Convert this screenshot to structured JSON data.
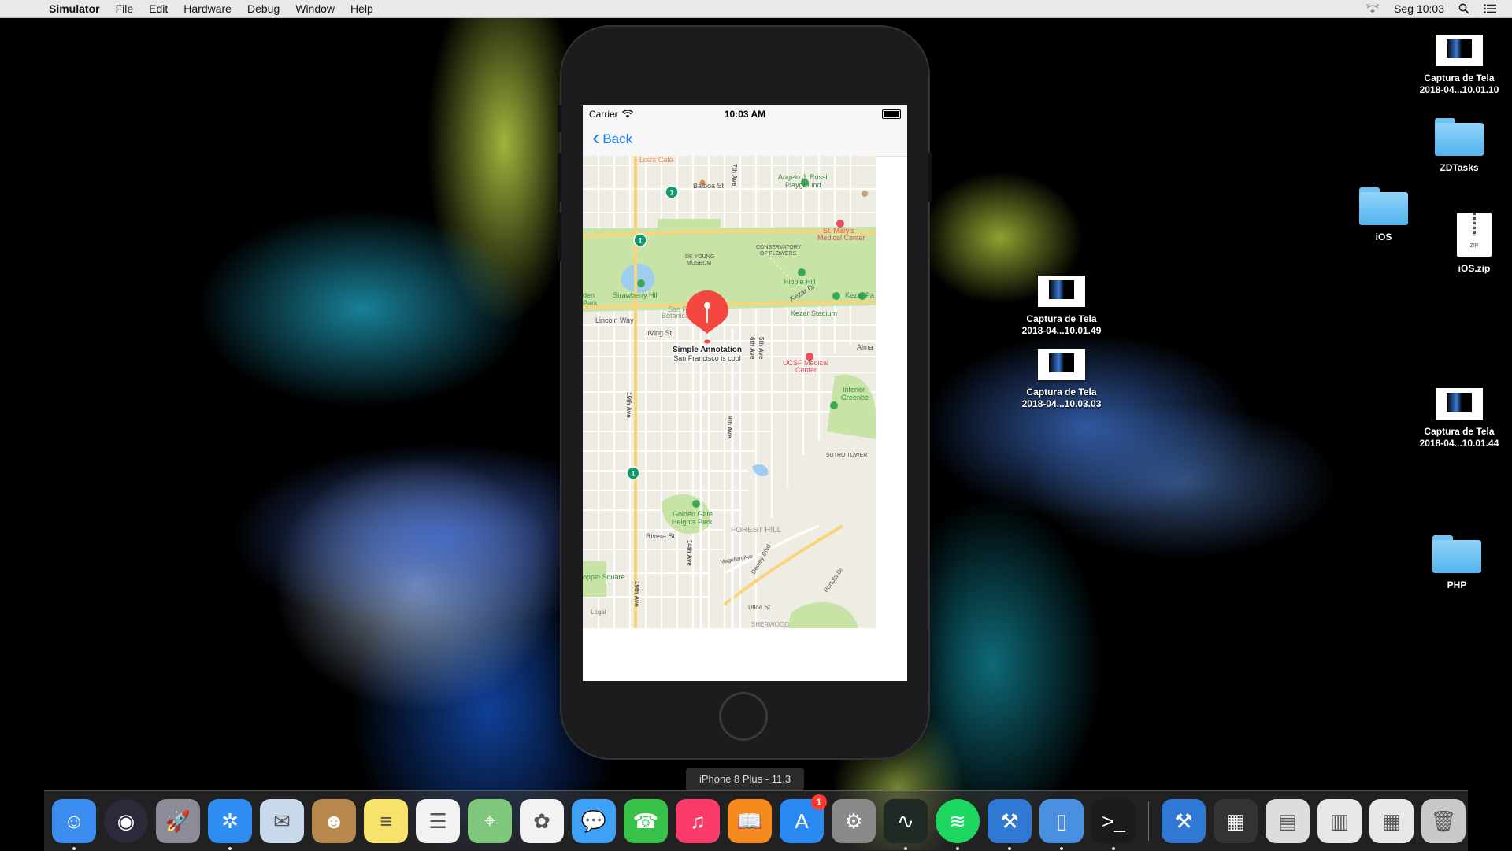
{
  "menubar": {
    "app_name": "Simulator",
    "items": [
      "File",
      "Edit",
      "Hardware",
      "Debug",
      "Window",
      "Help"
    ],
    "clock": "Seg 10:03"
  },
  "desktop": {
    "icons": [
      {
        "label": "Captura de Tela\n2018-04...10.01.10",
        "type": "screenshot"
      },
      {
        "label": "ZDTasks",
        "type": "folder"
      },
      {
        "label": "iOS",
        "type": "folder"
      },
      {
        "label": "iOS.zip",
        "type": "zip"
      },
      {
        "label": "Captura de Tela\n2018-04...10.01.49",
        "type": "screenshot"
      },
      {
        "label": "Captura de Tela\n2018-04...10.03.03",
        "type": "screenshot"
      },
      {
        "label": "Captura de Tela\n2018-04...10.01.44",
        "type": "screenshot"
      },
      {
        "label": "PHP",
        "type": "folder"
      }
    ]
  },
  "simulator": {
    "device_label": "iPhone 8 Plus - 11.3",
    "status_bar": {
      "carrier": "Carrier",
      "time": "10:03 AM"
    },
    "nav": {
      "back_label": "Back"
    },
    "map": {
      "annotation_title": "Simple Annotation",
      "annotation_subtitle": "San Francisco is cool",
      "legal": "Legal",
      "labels": {
        "lous_cafe": "Lou's Cafe",
        "balboa": "Balboa St",
        "rossi": "Angelo J. Rossi",
        "rossi2": "Playground",
        "st_marys": "St. Mary's",
        "st_marys2": "Medical Center",
        "conservatory": "CONSERVATORY",
        "conservatory2": "OF FLOWERS",
        "deyoung": "DE YOUNG",
        "deyoung2": "MUSEUM",
        "hippie": "Hippie Hill",
        "strawberry": "Strawberry Hill",
        "kezar_stadium": "Kezar Stadium",
        "kezar_dr": "Kezar Dr",
        "kezar_pa": "Kezar Pa",
        "botanical": "San Francisco",
        "botanical2": "Botanical Garden",
        "lincoln": "Lincoln Way",
        "irving": "Irving St",
        "ucsf": "UCSF Medical",
        "ucsf2": "Center",
        "interior": "Interior",
        "interior2": "Greenbe",
        "sutro": "SUTRO TOWER",
        "golden_gate": "Golden Gate",
        "golden_gate2": "Heights Park",
        "forest_hill": "FOREST HILL",
        "rivera": "Rivera St",
        "magellan": "Magellan Ave",
        "dewey": "Dewey Blvd",
        "portola": "Portola Dr",
        "ulloa": "Ulloa St",
        "sherwood": "SHERWOOD",
        "shopping_square": "oppin Square",
        "alma": "Alma",
        "seventh_ave": "7th Ave",
        "nineteenth_ave": "19th Ave",
        "ninth_ave": "9th Ave",
        "fifth_ave": "5th Ave",
        "sixth_ave": "6th Ave",
        "fourteenth_ave": "14th Ave",
        "park": "Park",
        "den": "den",
        "route": "1"
      }
    }
  },
  "dock": {
    "apps": [
      {
        "name": "Finder",
        "icon": "finder-icon",
        "color": "#3b8ef0",
        "running": true
      },
      {
        "name": "Siri",
        "icon": "siri-icon",
        "color": "#2a2a3a",
        "running": false
      },
      {
        "name": "Launchpad",
        "icon": "launchpad-icon",
        "color": "#8c8c98",
        "running": false
      },
      {
        "name": "Safari",
        "icon": "safari-icon",
        "color": "#2f8cf0",
        "running": true
      },
      {
        "name": "Mail",
        "icon": "mail-icon",
        "color": "#c9d9ec",
        "running": false
      },
      {
        "name": "Contacts",
        "icon": "contacts-icon",
        "color": "#b8874d",
        "running": false
      },
      {
        "name": "Notes",
        "icon": "notes-icon",
        "color": "#f7e36c",
        "running": false
      },
      {
        "name": "Reminders",
        "icon": "reminders-icon",
        "color": "#f2f2f2",
        "running": false
      },
      {
        "name": "Maps",
        "icon": "maps-icon",
        "color": "#7fc77c",
        "running": false
      },
      {
        "name": "Photos",
        "icon": "photos-icon",
        "color": "#f2f2f2",
        "running": false
      },
      {
        "name": "Messages",
        "icon": "messages-icon",
        "color": "#3fa1f7",
        "running": false
      },
      {
        "name": "FaceTime",
        "icon": "facetime-icon",
        "color": "#39c24a",
        "running": false
      },
      {
        "name": "iTunes",
        "icon": "itunes-icon",
        "color": "#fb3c6a",
        "running": false
      },
      {
        "name": "iBooks",
        "icon": "ibooks-icon",
        "color": "#f58a1f",
        "running": false
      },
      {
        "name": "App Store",
        "icon": "appstore-icon",
        "color": "#2a8af2",
        "running": false,
        "badge": "1"
      },
      {
        "name": "System Preferences",
        "icon": "gear-icon",
        "color": "#8a8a8a",
        "running": false
      },
      {
        "name": "Activity Monitor",
        "icon": "activity-monitor-icon",
        "color": "#1f2a24",
        "running": true
      },
      {
        "name": "Spotify",
        "icon": "spotify-icon",
        "color": "#1ed760",
        "running": true
      },
      {
        "name": "Xcode",
        "icon": "xcode-icon",
        "color": "#2f78d3",
        "running": true
      },
      {
        "name": "Simulator",
        "icon": "simulator-icon",
        "color": "#4a90e2",
        "running": true
      },
      {
        "name": "Terminal",
        "icon": "terminal-icon",
        "color": "#1b1b1b",
        "running": true
      }
    ],
    "others": [
      {
        "name": "Xcode Beta",
        "icon": "xcode-icon",
        "color": "#2f78d3"
      },
      {
        "name": "Screenshot Stack",
        "icon": "stack-icon",
        "color": "#333333"
      },
      {
        "name": "Documents",
        "icon": "documents-stack-icon",
        "color": "#dddddd"
      },
      {
        "name": "Downloads",
        "icon": "downloads-stack-icon",
        "color": "#e8e8e8"
      },
      {
        "name": "Applications",
        "icon": "applications-stack-icon",
        "color": "#e8e8e8"
      },
      {
        "name": "Trash",
        "icon": "trash-icon",
        "color": "#c8c8c8"
      }
    ]
  },
  "colors": {
    "ios_blue": "#1a7cf3",
    "pin_red": "#f3473f",
    "park_green": "#c7e3a5",
    "transit_green": "#0f9b6c"
  }
}
